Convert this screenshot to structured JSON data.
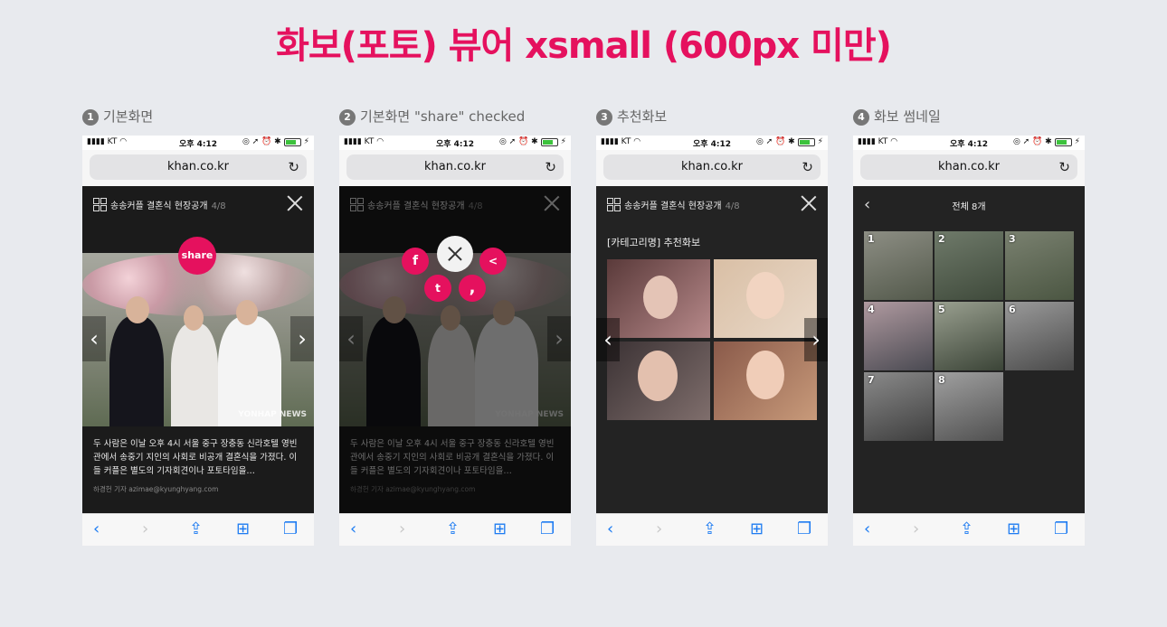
{
  "title": "화보(포토) 뷰어 xsmall (600px 미만)",
  "steps": [
    {
      "num": "1",
      "label": "기본화면"
    },
    {
      "num": "2",
      "label": "기본화면 \"share\" checked"
    },
    {
      "num": "3",
      "label": "추천화보"
    },
    {
      "num": "4",
      "label": "화보 썸네일"
    }
  ],
  "status": {
    "carrier": "KT",
    "time": "오후 4:12"
  },
  "browser": {
    "url": "khan.co.kr"
  },
  "viewer": {
    "gallery_title": "송송커플 결혼식 현장공개",
    "counter": "4/8",
    "share_label": "share",
    "watermark": "YONHAP NEWS",
    "caption": "두 사람은 이날 오후 4시 서울 중구 장충동 신라호텔 영빈관에서 송중기 지인의 사회로 비공개 결혼식을 가졌다. 이들 커플은 별도의 기자회견이나 포토타임을…",
    "byline": "하경헌 기자 azimae@kyunghyang.com"
  },
  "share_menu": {
    "facebook": "f",
    "twitter": "t",
    "kakao": "<",
    "story": ","
  },
  "recommend": {
    "title": "[카테고리명] 추천화보"
  },
  "thumbnails": {
    "title": "전체 8개",
    "items": [
      "1",
      "2",
      "3",
      "4",
      "5",
      "6",
      "7",
      "8"
    ]
  },
  "colors": {
    "accent": "#e5115e",
    "link_blue": "#1e7cf2"
  }
}
